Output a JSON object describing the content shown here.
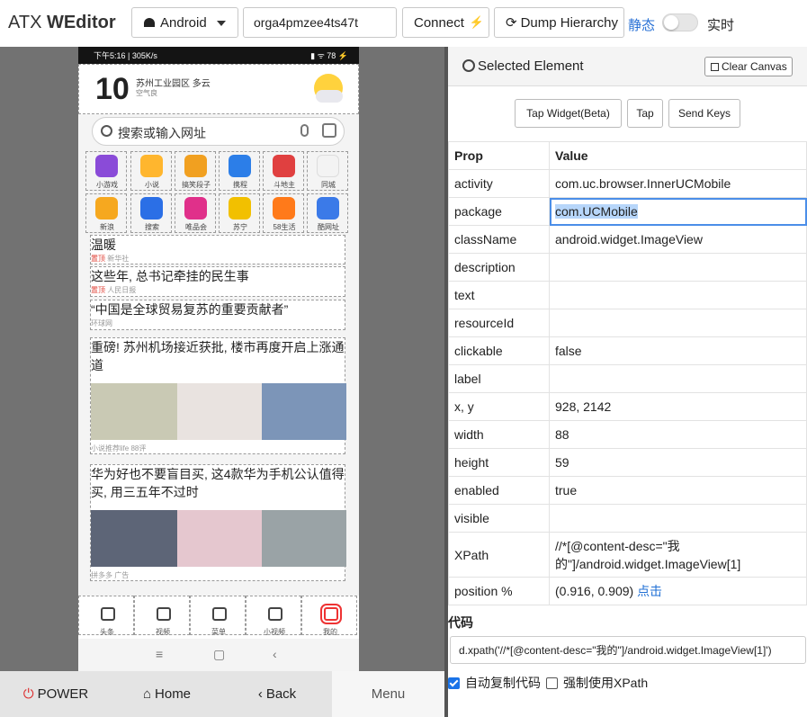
{
  "app": {
    "brand_light": "ATX ",
    "brand_bold": "WEditor"
  },
  "toolbar": {
    "platform": "Android",
    "serial": "orga4pmzee4ts47t",
    "connect_label": "Connect",
    "dump_label": "Dump Hierarchy",
    "mode_static": "静态",
    "mode_live": "实时"
  },
  "phone": {
    "status_left": "下午5:16 | 305K/s",
    "status_right": "▮ ᯤ 78 ⚡",
    "weather": {
      "temp": "10",
      "location": "苏州工业园区 多云",
      "sub": "空气良"
    },
    "search_placeholder": "搜索或输入网址",
    "apps": [
      {
        "label": "小游戏",
        "color": "#8a4bd8"
      },
      {
        "label": "小说",
        "color": "#ffb62e"
      },
      {
        "label": "搞笑段子",
        "color": "#f1a020"
      },
      {
        "label": "携程",
        "color": "#2c7ee8"
      },
      {
        "label": "斗地主",
        "color": "#e04040"
      },
      {
        "label": "同城",
        "color": "#f3f3f3"
      },
      {
        "label": "新浪",
        "color": "#f6a81f"
      },
      {
        "label": "搜索",
        "color": "#2b6fe6"
      },
      {
        "label": "唯品会",
        "color": "#e0308a"
      },
      {
        "label": "苏宁",
        "color": "#f2c000"
      },
      {
        "label": "58生活",
        "color": "#ff7a1a"
      },
      {
        "label": "酷网址",
        "color": "#3b7ae8"
      }
    ],
    "news": [
      {
        "title": "温暖",
        "tag": "置顶",
        "source": "新华社"
      },
      {
        "title": "这些年, 总书记牵挂的民生事",
        "tag": "置顶",
        "source": "人民日报"
      },
      {
        "title": "“中国是全球贸易复苏的重要贡献者”",
        "tag": "",
        "source": "环球网"
      },
      {
        "title": "重磅! 苏州机场接近获批, 楼市再度开启上涨通道",
        "tag": "",
        "source": "小说推荐life 88评"
      },
      {
        "title": "华为好也不要盲目买, 这4款华为手机公认值得买, 用三五年不过时",
        "tag": "",
        "source": "拼多多 广告"
      }
    ],
    "tabs": [
      "头条",
      "视频",
      "菜单",
      "小视频",
      "我的"
    ],
    "nav": [
      "≡",
      "▢",
      "‹"
    ]
  },
  "hardware": {
    "power": "POWER",
    "home": "Home",
    "back": "Back",
    "menu": "Menu"
  },
  "panel": {
    "title": "Selected Element",
    "clear_canvas": "Clear Canvas",
    "actions": [
      "Tap Widget(Beta)",
      "Tap",
      "Send Keys"
    ],
    "prop_header": "Prop",
    "value_header": "Value",
    "props": [
      {
        "k": "activity",
        "v": "com.uc.browser.InnerUCMobile"
      },
      {
        "k": "package",
        "v": "com.UCMobile"
      },
      {
        "k": "className",
        "v": "android.widget.ImageView"
      },
      {
        "k": "description",
        "v": ""
      },
      {
        "k": "text",
        "v": ""
      },
      {
        "k": "resourceId",
        "v": ""
      },
      {
        "k": "clickable",
        "v": "false"
      },
      {
        "k": "label",
        "v": ""
      },
      {
        "k": "x, y",
        "v": "928, 2142"
      },
      {
        "k": "width",
        "v": "88"
      },
      {
        "k": "height",
        "v": "59"
      },
      {
        "k": "enabled",
        "v": "true"
      },
      {
        "k": "visible",
        "v": ""
      },
      {
        "k": "XPath",
        "v": "//*[@content-desc=\"我的\"]/android.widget.ImageView[1]"
      }
    ],
    "position_label": "position %",
    "position_value": "(0.916, 0.909)",
    "position_link": "点击",
    "code_label": "代码",
    "code": "d.xpath('//*[@content-desc=\"我的\"]/android.widget.ImageView[1]')",
    "auto_copy": "自动复制代码",
    "force_xpath": "强制使用XPath"
  }
}
